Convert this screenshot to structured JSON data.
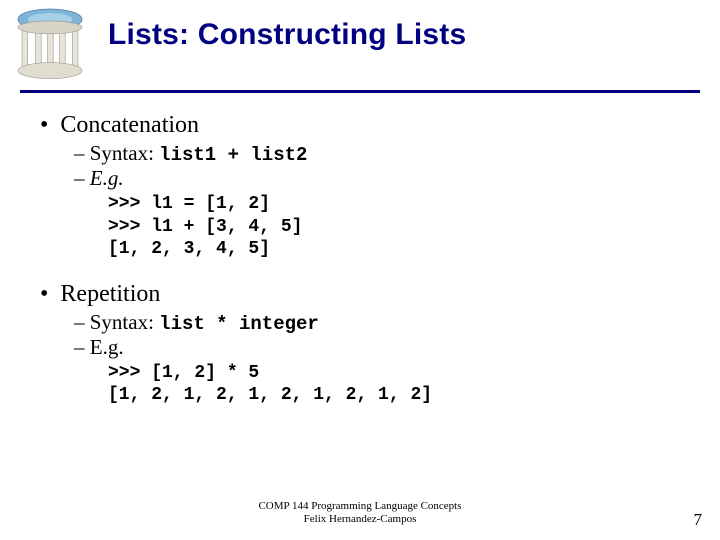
{
  "title": "Lists: Constructing Lists",
  "concat": {
    "heading": "Concatenation",
    "syntax_label": "Syntax:",
    "syntax_code": "list1 + list2",
    "eg_label": "E.g.",
    "code": ">>> l1 = [1, 2]\n>>> l1 + [3, 4, 5]\n[1, 2, 3, 4, 5]"
  },
  "repeat": {
    "heading": "Repetition",
    "syntax_label": "Syntax:",
    "syntax_code": "list * integer",
    "eg_label": "E.g.",
    "code": ">>> [1, 2] * 5\n[1, 2, 1, 2, 1, 2, 1, 2, 1, 2]"
  },
  "footer": {
    "line1": "COMP 144 Programming Language Concepts",
    "line2": "Felix Hernandez-Campos"
  },
  "page": "7"
}
